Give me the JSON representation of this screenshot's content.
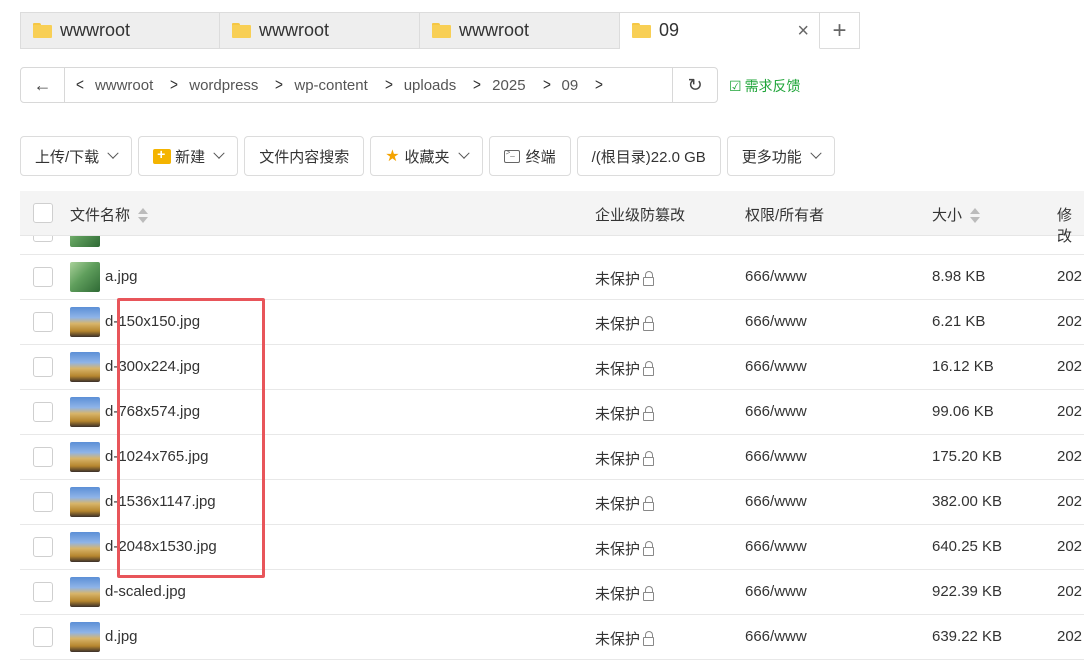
{
  "tabs": [
    {
      "label": "wwwroot"
    },
    {
      "label": "wwwroot"
    },
    {
      "label": "wwwroot"
    },
    {
      "label": "09",
      "close": "×"
    }
  ],
  "tab_add": "+",
  "path": {
    "back": "←",
    "left_arrow": "<",
    "crumbs": [
      "wwwroot",
      "wordpress",
      "wp-content",
      "uploads",
      "2025",
      "09"
    ],
    "separator": ">",
    "refresh": "↻"
  },
  "feedback": {
    "icon": "☑",
    "label": "需求反馈"
  },
  "toolbar": {
    "upload": "上传/下载",
    "new": "新建",
    "search": "文件内容搜索",
    "favorites": "收藏夹",
    "terminal": "终端",
    "disk": "/(根目录)22.0 GB",
    "more": "更多功能"
  },
  "table": {
    "headers": {
      "name": "文件名称",
      "protect": "企业级防篡改",
      "perm": "权限/所有者",
      "size": "大小",
      "modified": "修改"
    },
    "rows": [
      {
        "name": "a.jpg",
        "protect": "未保护",
        "perm": "666/www",
        "size": "8.98 KB",
        "mod": "202",
        "thumb": "leaf"
      },
      {
        "name": "d-150x150.jpg",
        "protect": "未保护",
        "perm": "666/www",
        "size": "6.21 KB",
        "mod": "202",
        "thumb": "photo"
      },
      {
        "name": "d-300x224.jpg",
        "protect": "未保护",
        "perm": "666/www",
        "size": "16.12 KB",
        "mod": "202",
        "thumb": "photo"
      },
      {
        "name": "d-768x574.jpg",
        "protect": "未保护",
        "perm": "666/www",
        "size": "99.06 KB",
        "mod": "202",
        "thumb": "photo"
      },
      {
        "name": "d-1024x765.jpg",
        "protect": "未保护",
        "perm": "666/www",
        "size": "175.20 KB",
        "mod": "202",
        "thumb": "photo"
      },
      {
        "name": "d-1536x1147.jpg",
        "protect": "未保护",
        "perm": "666/www",
        "size": "382.00 KB",
        "mod": "202",
        "thumb": "photo"
      },
      {
        "name": "d-2048x1530.jpg",
        "protect": "未保护",
        "perm": "666/www",
        "size": "640.25 KB",
        "mod": "202",
        "thumb": "photo"
      },
      {
        "name": "d-scaled.jpg",
        "protect": "未保护",
        "perm": "666/www",
        "size": "922.39 KB",
        "mod": "202",
        "thumb": "photo"
      },
      {
        "name": "d.jpg",
        "protect": "未保护",
        "perm": "666/www",
        "size": "639.22 KB",
        "mod": "202",
        "thumb": "photo"
      }
    ]
  },
  "colors": {
    "accent_green": "#20a53a",
    "highlight_red": "#e8555a",
    "folder_yellow": "#f8cf55"
  }
}
